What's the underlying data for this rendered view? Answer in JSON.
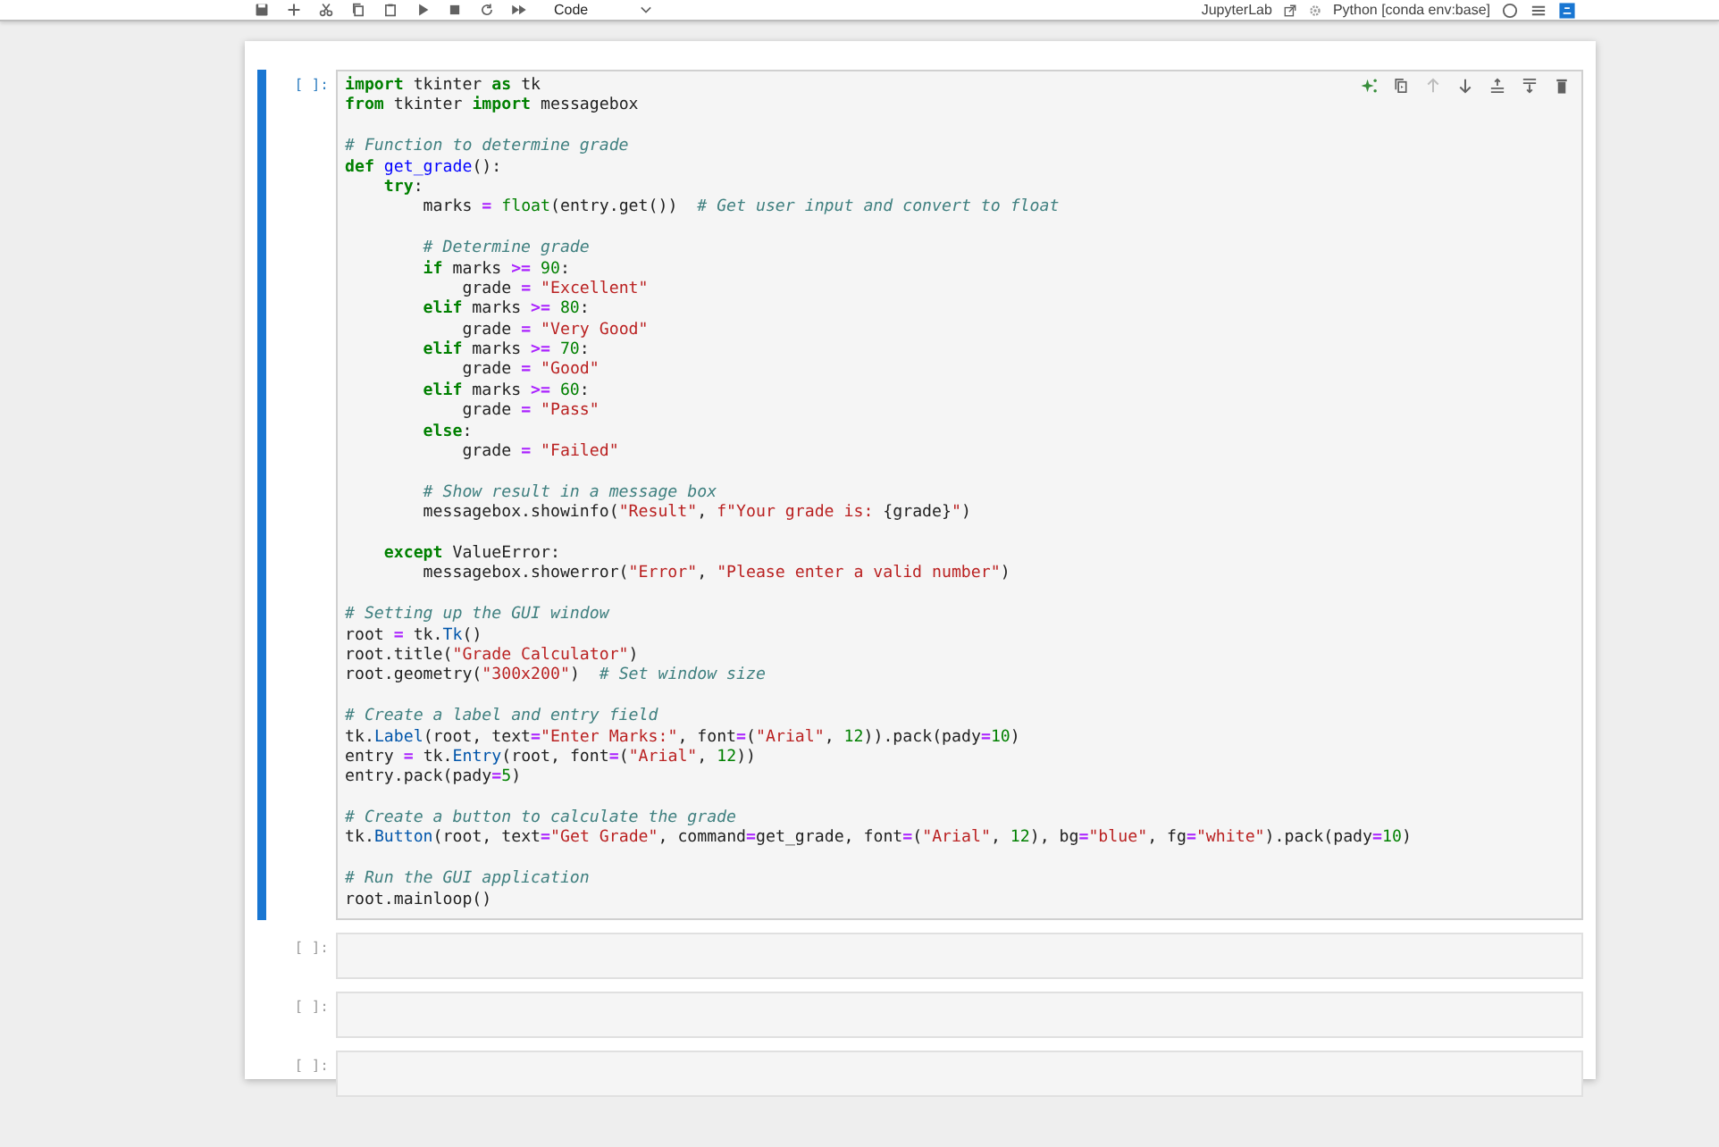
{
  "toolbar": {
    "cell_type": "Code",
    "app_link": "JupyterLab",
    "kernel": "Python [conda env:base]",
    "kernel_busy": false
  },
  "cells": [
    {
      "prompt": "[ ]:",
      "selected": true,
      "lines": [
        {
          "kind": "code",
          "tokens": [
            {
              "kind": "kw",
              "text": "import"
            },
            {
              "kind": "plain",
              "text": " tkinter "
            },
            {
              "kind": "kw",
              "text": "as"
            },
            {
              "kind": "plain",
              "text": " tk"
            }
          ]
        },
        {
          "kind": "code",
          "tokens": [
            {
              "kind": "kw",
              "text": "from"
            },
            {
              "kind": "plain",
              "text": " tkinter "
            },
            {
              "kind": "kw",
              "text": "import"
            },
            {
              "kind": "plain",
              "text": " messagebox"
            }
          ]
        },
        {
          "kind": "blank"
        },
        {
          "kind": "code",
          "tokens": [
            {
              "kind": "comment",
              "text": "# Function to determine grade"
            }
          ]
        },
        {
          "kind": "code",
          "tokens": [
            {
              "kind": "kw",
              "text": "def"
            },
            {
              "kind": "func",
              "text": " get_grade"
            },
            {
              "kind": "plain",
              "text": "():"
            }
          ]
        },
        {
          "kind": "code",
          "tokens": [
            {
              "kind": "kw",
              "text": "    try"
            },
            {
              "kind": "plain",
              "text": ":"
            }
          ]
        },
        {
          "kind": "code",
          "tokens": [
            {
              "kind": "plain",
              "text": "        marks "
            },
            {
              "kind": "op",
              "text": "="
            },
            {
              "kind": "builtin",
              "text": " float"
            },
            {
              "kind": "plain",
              "text": "(entry.get())  "
            },
            {
              "kind": "comment",
              "text": "# Get user input and convert to float"
            }
          ]
        },
        {
          "kind": "blank"
        },
        {
          "kind": "code",
          "tokens": [
            {
              "kind": "comment",
              "text": "        # Determine grade"
            }
          ]
        },
        {
          "kind": "code",
          "tokens": [
            {
              "kind": "kw",
              "text": "        if"
            },
            {
              "kind": "plain",
              "text": " marks "
            },
            {
              "kind": "op",
              "text": ">="
            },
            {
              "kind": "num",
              "text": " 90"
            },
            {
              "kind": "plain",
              "text": ":"
            }
          ]
        },
        {
          "kind": "code",
          "tokens": [
            {
              "kind": "plain",
              "text": "            grade "
            },
            {
              "kind": "op",
              "text": "="
            },
            {
              "kind": "str",
              "text": " \"Excellent\""
            }
          ]
        },
        {
          "kind": "code",
          "tokens": [
            {
              "kind": "kw",
              "text": "        elif"
            },
            {
              "kind": "plain",
              "text": " marks "
            },
            {
              "kind": "op",
              "text": ">="
            },
            {
              "kind": "num",
              "text": " 80"
            },
            {
              "kind": "plain",
              "text": ":"
            }
          ]
        },
        {
          "kind": "code",
          "tokens": [
            {
              "kind": "plain",
              "text": "            grade "
            },
            {
              "kind": "op",
              "text": "="
            },
            {
              "kind": "str",
              "text": " \"Very Good\""
            }
          ]
        },
        {
          "kind": "code",
          "tokens": [
            {
              "kind": "kw",
              "text": "        elif"
            },
            {
              "kind": "plain",
              "text": " marks "
            },
            {
              "kind": "op",
              "text": ">="
            },
            {
              "kind": "num",
              "text": " 70"
            },
            {
              "kind": "plain",
              "text": ":"
            }
          ]
        },
        {
          "kind": "code",
          "tokens": [
            {
              "kind": "plain",
              "text": "            grade "
            },
            {
              "kind": "op",
              "text": "="
            },
            {
              "kind": "str",
              "text": " \"Good\""
            }
          ]
        },
        {
          "kind": "code",
          "tokens": [
            {
              "kind": "kw",
              "text": "        elif"
            },
            {
              "kind": "plain",
              "text": " marks "
            },
            {
              "kind": "op",
              "text": ">="
            },
            {
              "kind": "num",
              "text": " 60"
            },
            {
              "kind": "plain",
              "text": ":"
            }
          ]
        },
        {
          "kind": "code",
          "tokens": [
            {
              "kind": "plain",
              "text": "            grade "
            },
            {
              "kind": "op",
              "text": "="
            },
            {
              "kind": "str",
              "text": " \"Pass\""
            }
          ]
        },
        {
          "kind": "code",
          "tokens": [
            {
              "kind": "kw",
              "text": "        else"
            },
            {
              "kind": "plain",
              "text": ":"
            }
          ]
        },
        {
          "kind": "code",
          "tokens": [
            {
              "kind": "plain",
              "text": "            grade "
            },
            {
              "kind": "op",
              "text": "="
            },
            {
              "kind": "str",
              "text": " \"Failed\""
            }
          ]
        },
        {
          "kind": "blank"
        },
        {
          "kind": "code",
          "tokens": [
            {
              "kind": "comment",
              "text": "        # Show result in a message box"
            }
          ]
        },
        {
          "kind": "code",
          "tokens": [
            {
              "kind": "plain",
              "text": "        messagebox.showinfo("
            },
            {
              "kind": "str",
              "text": "\"Result\""
            },
            {
              "kind": "plain",
              "text": ", "
            },
            {
              "kind": "str",
              "text": "f\"Your grade is: "
            },
            {
              "kind": "plain",
              "text": "{grade}"
            },
            {
              "kind": "str",
              "text": "\""
            },
            {
              "kind": "plain",
              "text": ")"
            }
          ]
        },
        {
          "kind": "blank"
        },
        {
          "kind": "code",
          "tokens": [
            {
              "kind": "kw",
              "text": "    except"
            },
            {
              "kind": "plain",
              "text": " ValueError:"
            }
          ]
        },
        {
          "kind": "code",
          "tokens": [
            {
              "kind": "plain",
              "text": "        messagebox.showerror("
            },
            {
              "kind": "str",
              "text": "\"Error\""
            },
            {
              "kind": "plain",
              "text": ", "
            },
            {
              "kind": "str",
              "text": "\"Please enter a valid number\""
            },
            {
              "kind": "plain",
              "text": ")"
            }
          ]
        },
        {
          "kind": "blank"
        },
        {
          "kind": "code",
          "tokens": [
            {
              "kind": "comment",
              "text": "# Setting up the GUI window"
            }
          ]
        },
        {
          "kind": "code",
          "tokens": [
            {
              "kind": "plain",
              "text": "root "
            },
            {
              "kind": "op",
              "text": "="
            },
            {
              "kind": "plain",
              "text": " tk."
            },
            {
              "kind": "attr",
              "text": "Tk"
            },
            {
              "kind": "plain",
              "text": "()"
            }
          ]
        },
        {
          "kind": "code",
          "tokens": [
            {
              "kind": "plain",
              "text": "root.title("
            },
            {
              "kind": "str",
              "text": "\"Grade Calculator\""
            },
            {
              "kind": "plain",
              "text": ")"
            }
          ]
        },
        {
          "kind": "code",
          "tokens": [
            {
              "kind": "plain",
              "text": "root.geometry("
            },
            {
              "kind": "str",
              "text": "\"300x200\""
            },
            {
              "kind": "plain",
              "text": ")  "
            },
            {
              "kind": "comment",
              "text": "# Set window size"
            }
          ]
        },
        {
          "kind": "blank"
        },
        {
          "kind": "code",
          "tokens": [
            {
              "kind": "comment",
              "text": "# Create a label and entry field"
            }
          ]
        },
        {
          "kind": "code",
          "tokens": [
            {
              "kind": "plain",
              "text": "tk."
            },
            {
              "kind": "attr",
              "text": "Label"
            },
            {
              "kind": "plain",
              "text": "(root, text"
            },
            {
              "kind": "op",
              "text": "="
            },
            {
              "kind": "str",
              "text": "\"Enter Marks:\""
            },
            {
              "kind": "plain",
              "text": ", font"
            },
            {
              "kind": "op",
              "text": "="
            },
            {
              "kind": "plain",
              "text": "("
            },
            {
              "kind": "str",
              "text": "\"Arial\""
            },
            {
              "kind": "plain",
              "text": ", "
            },
            {
              "kind": "num",
              "text": "12"
            },
            {
              "kind": "plain",
              "text": ")).pack(pady"
            },
            {
              "kind": "op",
              "text": "="
            },
            {
              "kind": "num",
              "text": "10"
            },
            {
              "kind": "plain",
              "text": ")"
            }
          ]
        },
        {
          "kind": "code",
          "tokens": [
            {
              "kind": "plain",
              "text": "entry "
            },
            {
              "kind": "op",
              "text": "="
            },
            {
              "kind": "plain",
              "text": " tk."
            },
            {
              "kind": "attr",
              "text": "Entry"
            },
            {
              "kind": "plain",
              "text": "(root, font"
            },
            {
              "kind": "op",
              "text": "="
            },
            {
              "kind": "plain",
              "text": "("
            },
            {
              "kind": "str",
              "text": "\"Arial\""
            },
            {
              "kind": "plain",
              "text": ", "
            },
            {
              "kind": "num",
              "text": "12"
            },
            {
              "kind": "plain",
              "text": "))"
            }
          ]
        },
        {
          "kind": "code",
          "tokens": [
            {
              "kind": "plain",
              "text": "entry.pack(pady"
            },
            {
              "kind": "op",
              "text": "="
            },
            {
              "kind": "num",
              "text": "5"
            },
            {
              "kind": "plain",
              "text": ")"
            }
          ]
        },
        {
          "kind": "blank"
        },
        {
          "kind": "code",
          "tokens": [
            {
              "kind": "comment",
              "text": "# Create a button to calculate the grade"
            }
          ]
        },
        {
          "kind": "code",
          "tokens": [
            {
              "kind": "plain",
              "text": "tk."
            },
            {
              "kind": "attr",
              "text": "Button"
            },
            {
              "kind": "plain",
              "text": "(root, text"
            },
            {
              "kind": "op",
              "text": "="
            },
            {
              "kind": "str",
              "text": "\"Get Grade\""
            },
            {
              "kind": "plain",
              "text": ", command"
            },
            {
              "kind": "op",
              "text": "="
            },
            {
              "kind": "plain",
              "text": "get_grade, font"
            },
            {
              "kind": "op",
              "text": "="
            },
            {
              "kind": "plain",
              "text": "("
            },
            {
              "kind": "str",
              "text": "\"Arial\""
            },
            {
              "kind": "plain",
              "text": ", "
            },
            {
              "kind": "num",
              "text": "12"
            },
            {
              "kind": "plain",
              "text": "), bg"
            },
            {
              "kind": "op",
              "text": "="
            },
            {
              "kind": "str",
              "text": "\"blue\""
            },
            {
              "kind": "plain",
              "text": ", fg"
            },
            {
              "kind": "op",
              "text": "="
            },
            {
              "kind": "str",
              "text": "\"white\""
            },
            {
              "kind": "plain",
              "text": ").pack(pady"
            },
            {
              "kind": "op",
              "text": "="
            },
            {
              "kind": "num",
              "text": "10"
            },
            {
              "kind": "plain",
              "text": ")"
            }
          ]
        },
        {
          "kind": "blank"
        },
        {
          "kind": "code",
          "tokens": [
            {
              "kind": "comment",
              "text": "# Run the GUI application"
            }
          ]
        },
        {
          "kind": "code",
          "tokens": [
            {
              "kind": "plain",
              "text": "root.mainloop()"
            }
          ]
        }
      ]
    },
    {
      "prompt": "[ ]:",
      "selected": false
    },
    {
      "prompt": "[ ]:",
      "selected": false
    },
    {
      "prompt": "[ ]:",
      "selected": false
    }
  ]
}
